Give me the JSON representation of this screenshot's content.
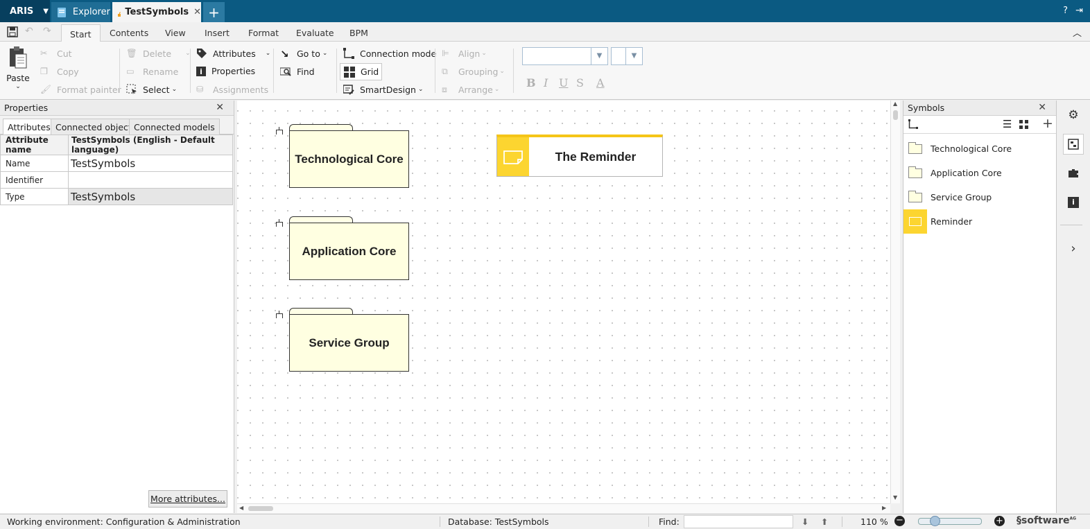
{
  "app": {
    "name": "ARIS",
    "tabs": [
      {
        "label": "Explorer"
      },
      {
        "label": "TestSymbols"
      }
    ],
    "help": "?"
  },
  "ribbon_tabs": [
    "Start",
    "Contents",
    "View",
    "Insert",
    "Format",
    "Evaluate",
    "BPM"
  ],
  "ribbon": {
    "paste": "Paste",
    "cut": "Cut",
    "copy": "Copy",
    "format_painter": "Format painter",
    "delete": "Delete",
    "rename": "Rename",
    "select": "Select",
    "attributes": "Attributes",
    "properties": "Properties",
    "assignments": "Assignments",
    "goto": "Go to",
    "find": "Find",
    "connection_mode": "Connection mode",
    "grid": "Grid",
    "smartdesign": "SmartDesign",
    "align": "Align",
    "grouping": "Grouping",
    "arrange": "Arrange",
    "bold": "B",
    "italic": "I",
    "underline": "U",
    "strike": "S",
    "fontcolor": "A"
  },
  "properties_panel": {
    "title": "Properties",
    "subtabs": [
      "Attributes",
      "Connected objects",
      "Connected models"
    ],
    "header": {
      "col1": "Attribute name",
      "col2": "TestSymbols (English - Default language)"
    },
    "rows": [
      {
        "name": "Name",
        "value": "TestSymbols"
      },
      {
        "name": "Identifier",
        "value": ""
      },
      {
        "name": "Type",
        "value": "TestSymbols"
      }
    ],
    "more_button": "More attributes..."
  },
  "canvas": {
    "folders": [
      {
        "label": "Technological Core"
      },
      {
        "label": "Application Core"
      },
      {
        "label": "Service Group"
      }
    ],
    "reminder": {
      "label": "The Reminder",
      "color": "#fcd530"
    }
  },
  "symbols_panel": {
    "title": "Symbols",
    "items": [
      {
        "label": "Technological Core",
        "icon": "folder-icon"
      },
      {
        "label": "Application Core",
        "icon": "folder-icon"
      },
      {
        "label": "Service Group",
        "icon": "folder-icon"
      },
      {
        "label": "Reminder",
        "icon": "note-icon"
      }
    ]
  },
  "status": {
    "environment": "Working environment: Configuration & Administration",
    "database": "Database: TestSymbols",
    "find_label": "Find:",
    "zoom": "110 %",
    "brand": "software",
    "brand_suffix": "AG"
  },
  "colors": {
    "titlebar": "#0b5a82",
    "accent": "#fcd530",
    "folder_fill": "#ffffe1"
  }
}
